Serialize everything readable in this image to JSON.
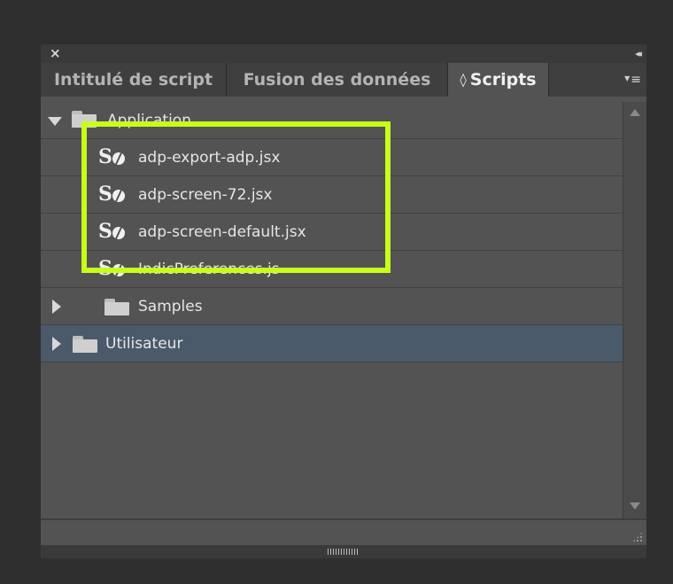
{
  "panel": {
    "titlebar": {
      "close_glyph": "×",
      "collapse_glyph": "◂◂"
    },
    "tabs": [
      {
        "label": "Intitulé de script",
        "active": false
      },
      {
        "label": "Fusion des données",
        "active": false
      },
      {
        "label": "Scripts",
        "active": true,
        "glyph": "◊"
      }
    ],
    "menu_glyph": "≡"
  },
  "tree": {
    "items": [
      {
        "label": "Application",
        "type": "folder",
        "expanded": true
      },
      {
        "label": "adp-export-adp.jsx",
        "type": "script"
      },
      {
        "label": "adp-screen-72.jsx",
        "type": "script"
      },
      {
        "label": "adp-screen-default.jsx",
        "type": "script"
      },
      {
        "label": "IndicPreferences.js",
        "type": "script"
      },
      {
        "label": "Samples",
        "type": "folder",
        "expanded": false
      },
      {
        "label": "Utilisateur",
        "type": "folder",
        "expanded": false,
        "selected": true
      }
    ]
  },
  "colors": {
    "highlight": "#c6ff1a",
    "selected_row": "#4a5a6b"
  }
}
